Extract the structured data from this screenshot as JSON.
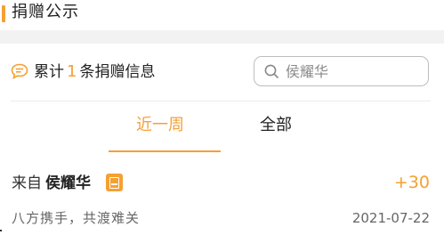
{
  "header": {
    "title": "捐赠公示"
  },
  "summary": {
    "prefix": "累计",
    "count": "1",
    "suffix": "条捐赠信息"
  },
  "search": {
    "placeholder": "侯耀华"
  },
  "tabs": [
    {
      "label": "近一周",
      "active": true
    },
    {
      "label": "全部",
      "active": false
    }
  ],
  "record": {
    "from_label": "来自",
    "donor": "侯耀华",
    "amount": "+30",
    "message": "八方携手，共渡难关",
    "date": "2021-07-22"
  },
  "colors": {
    "accent": "#f5a033",
    "background_gap": "#f2f2f2"
  },
  "icons": [
    "chat-bubble-icon",
    "search-icon",
    "certificate-icon"
  ]
}
